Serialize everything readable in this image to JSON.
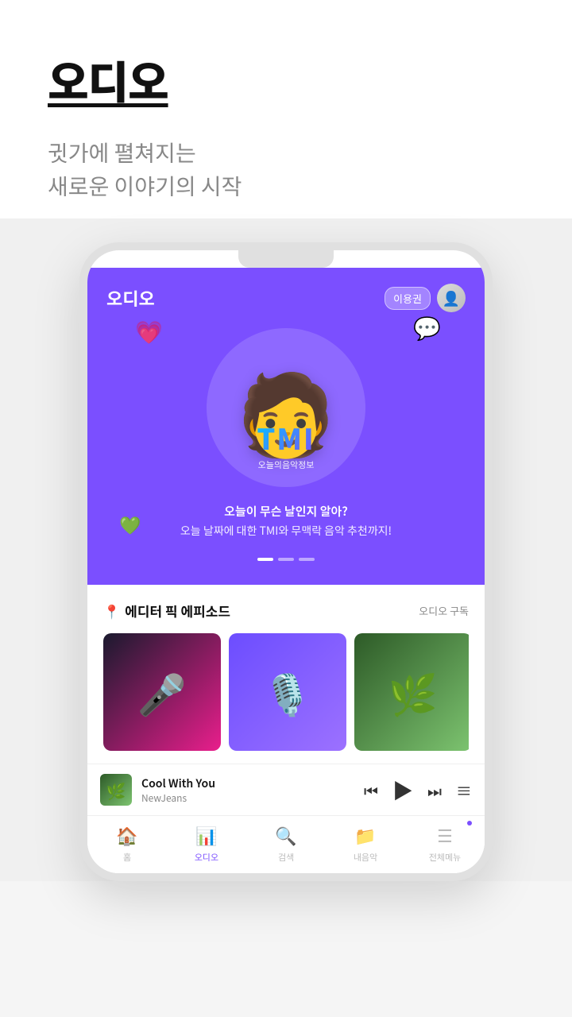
{
  "hero": {
    "title": "오디오",
    "subtitle_line1": "귓가에 펼쳐지는",
    "subtitle_line2": "새로운 이야기의 시작"
  },
  "app": {
    "logo": "오디오",
    "user_badge": "이용권",
    "banner": {
      "tmi_title": "TMI",
      "tmi_sub": "오늘의음악정보",
      "text_main": "오늘이 무슨 날인지 알아?",
      "text_sub": "오늘 날짜에 대한 TMI와 무맥락 음악 추천까지!"
    },
    "section": {
      "icon": "📍",
      "title": "에디터 픽 에피소드",
      "action": "오디오 구독"
    },
    "now_playing": {
      "title": "Cool With You",
      "artist": "NewJeans"
    },
    "nav": {
      "items": [
        {
          "icon": "🏠",
          "label": "홈",
          "active": false
        },
        {
          "icon": "📊",
          "label": "오디오",
          "active": true
        },
        {
          "icon": "🔍",
          "label": "검색",
          "active": false
        },
        {
          "icon": "📁",
          "label": "내음악",
          "active": false
        },
        {
          "icon": "☰",
          "label": "전체메뉴",
          "active": false,
          "has_dot": true
        }
      ]
    }
  }
}
